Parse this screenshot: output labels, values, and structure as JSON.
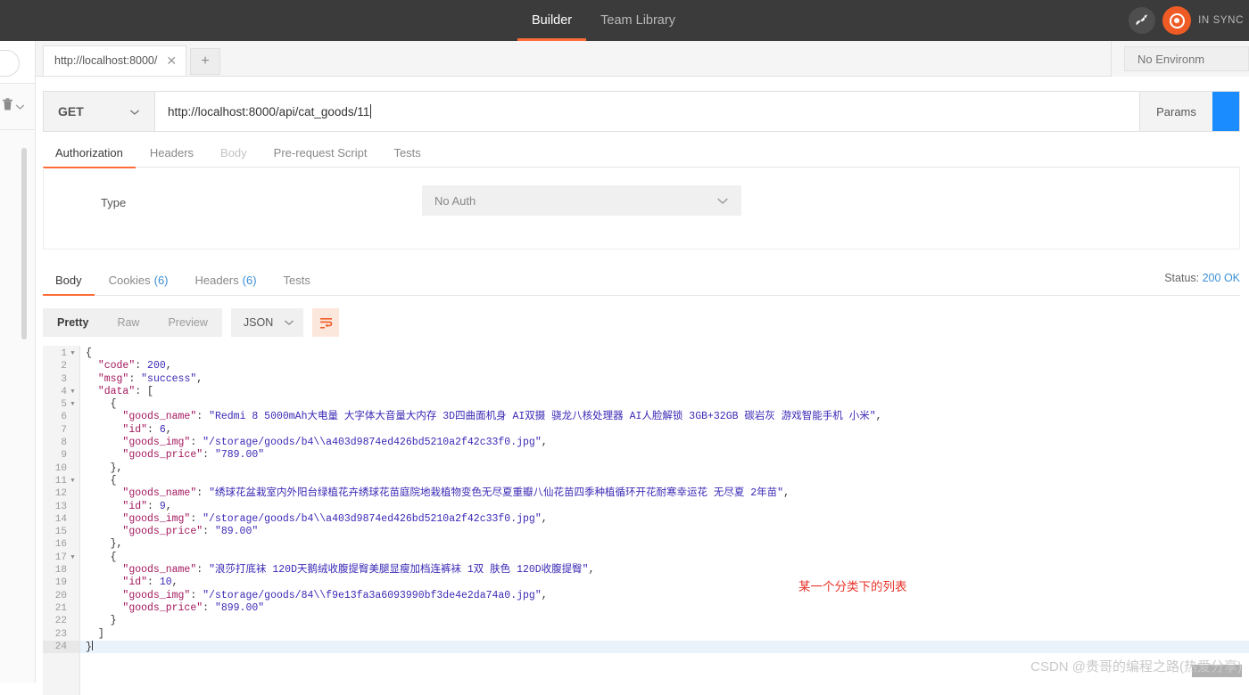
{
  "topbar": {
    "nav": [
      {
        "label": "Builder",
        "active": true
      },
      {
        "label": "Team Library",
        "active": false
      }
    ],
    "dish_icon": "satellite-dish-icon",
    "sync_logo": "postman-sync-logo",
    "sync_status": "IN SYNC"
  },
  "left_rail": {
    "trash_icon": "trash-icon",
    "chevron_icon": "chevron-down-icon"
  },
  "tabstrip": {
    "tabs": [
      {
        "label": "http://localhost:8000/",
        "close_icon": "close-icon"
      }
    ],
    "add_label": "+",
    "environment": "No Environm"
  },
  "request": {
    "method": "GET",
    "method_chevron": "chevron-down-icon",
    "url": "http://localhost:8000/api/cat_goods/11",
    "params_label": "Params",
    "tabs": [
      {
        "label": "Authorization",
        "state": "active"
      },
      {
        "label": "Headers",
        "state": "normal"
      },
      {
        "label": "Body",
        "state": "disabled"
      },
      {
        "label": "Pre-request Script",
        "state": "normal"
      },
      {
        "label": "Tests",
        "state": "normal"
      }
    ],
    "auth": {
      "type_label": "Type",
      "type_value": "No Auth",
      "chevron_icon": "chevron-down-icon"
    }
  },
  "response": {
    "tabs": [
      {
        "label": "Body",
        "count": "",
        "state": "active"
      },
      {
        "label": "Cookies",
        "count": "(6)",
        "state": "normal"
      },
      {
        "label": "Headers",
        "count": "(6)",
        "state": "normal"
      },
      {
        "label": "Tests",
        "count": "",
        "state": "normal"
      }
    ],
    "status_label": "Status:",
    "status_value": "200 OK",
    "view_modes": [
      {
        "label": "Pretty",
        "active": true
      },
      {
        "label": "Raw",
        "active": false
      },
      {
        "label": "Preview",
        "active": false
      }
    ],
    "format": "JSON",
    "format_chevron": "chevron-down-icon",
    "wrap_icon": "word-wrap-icon",
    "line_count": 24,
    "fold_lines": [
      1,
      4,
      5,
      11,
      17
    ],
    "highlight_line": 24,
    "code_lines": [
      {
        "n": 1,
        "indent": 0,
        "tokens": [
          {
            "t": "p",
            "v": "{"
          }
        ]
      },
      {
        "n": 2,
        "indent": 1,
        "tokens": [
          {
            "t": "k",
            "v": "\"code\""
          },
          {
            "t": "p",
            "v": ": "
          },
          {
            "t": "n",
            "v": "200"
          },
          {
            "t": "p",
            "v": ","
          }
        ]
      },
      {
        "n": 3,
        "indent": 1,
        "tokens": [
          {
            "t": "k",
            "v": "\"msg\""
          },
          {
            "t": "p",
            "v": ": "
          },
          {
            "t": "s",
            "v": "\"success\""
          },
          {
            "t": "p",
            "v": ","
          }
        ]
      },
      {
        "n": 4,
        "indent": 1,
        "tokens": [
          {
            "t": "k",
            "v": "\"data\""
          },
          {
            "t": "p",
            "v": ": ["
          }
        ]
      },
      {
        "n": 5,
        "indent": 2,
        "tokens": [
          {
            "t": "p",
            "v": "{"
          }
        ]
      },
      {
        "n": 6,
        "indent": 3,
        "tokens": [
          {
            "t": "k",
            "v": "\"goods_name\""
          },
          {
            "t": "p",
            "v": ": "
          },
          {
            "t": "s",
            "v": "\"Redmi 8 5000mAh大电量 大字体大音量大内存 3D四曲面机身 AI双摄 骁龙八核处理器 AI人脸解锁 3GB+32GB 碳岩灰 游戏智能手机 小米\""
          },
          {
            "t": "p",
            "v": ","
          }
        ]
      },
      {
        "n": 7,
        "indent": 3,
        "tokens": [
          {
            "t": "k",
            "v": "\"id\""
          },
          {
            "t": "p",
            "v": ": "
          },
          {
            "t": "n",
            "v": "6"
          },
          {
            "t": "p",
            "v": ","
          }
        ]
      },
      {
        "n": 8,
        "indent": 3,
        "tokens": [
          {
            "t": "k",
            "v": "\"goods_img\""
          },
          {
            "t": "p",
            "v": ": "
          },
          {
            "t": "s",
            "v": "\"/storage/goods/b4\\\\a403d9874ed426bd5210a2f42c33f0.jpg\""
          },
          {
            "t": "p",
            "v": ","
          }
        ]
      },
      {
        "n": 9,
        "indent": 3,
        "tokens": [
          {
            "t": "k",
            "v": "\"goods_price\""
          },
          {
            "t": "p",
            "v": ": "
          },
          {
            "t": "s",
            "v": "\"789.00\""
          }
        ]
      },
      {
        "n": 10,
        "indent": 2,
        "tokens": [
          {
            "t": "p",
            "v": "},"
          }
        ]
      },
      {
        "n": 11,
        "indent": 2,
        "tokens": [
          {
            "t": "p",
            "v": "{"
          }
        ]
      },
      {
        "n": 12,
        "indent": 3,
        "tokens": [
          {
            "t": "k",
            "v": "\"goods_name\""
          },
          {
            "t": "p",
            "v": ": "
          },
          {
            "t": "s",
            "v": "\"绣球花盆栽室内外阳台绿植花卉绣球花苗庭院地栽植物变色无尽夏重瓣八仙花苗四季种植循环开花耐寒幸运花 无尽夏 2年苗\""
          },
          {
            "t": "p",
            "v": ","
          }
        ]
      },
      {
        "n": 13,
        "indent": 3,
        "tokens": [
          {
            "t": "k",
            "v": "\"id\""
          },
          {
            "t": "p",
            "v": ": "
          },
          {
            "t": "n",
            "v": "9"
          },
          {
            "t": "p",
            "v": ","
          }
        ]
      },
      {
        "n": 14,
        "indent": 3,
        "tokens": [
          {
            "t": "k",
            "v": "\"goods_img\""
          },
          {
            "t": "p",
            "v": ": "
          },
          {
            "t": "s",
            "v": "\"/storage/goods/b4\\\\a403d9874ed426bd5210a2f42c33f0.jpg\""
          },
          {
            "t": "p",
            "v": ","
          }
        ]
      },
      {
        "n": 15,
        "indent": 3,
        "tokens": [
          {
            "t": "k",
            "v": "\"goods_price\""
          },
          {
            "t": "p",
            "v": ": "
          },
          {
            "t": "s",
            "v": "\"89.00\""
          }
        ]
      },
      {
        "n": 16,
        "indent": 2,
        "tokens": [
          {
            "t": "p",
            "v": "},"
          }
        ]
      },
      {
        "n": 17,
        "indent": 2,
        "tokens": [
          {
            "t": "p",
            "v": "{"
          }
        ]
      },
      {
        "n": 18,
        "indent": 3,
        "tokens": [
          {
            "t": "k",
            "v": "\"goods_name\""
          },
          {
            "t": "p",
            "v": ": "
          },
          {
            "t": "s",
            "v": "\"浪莎打底袜 120D天鹅绒收腹提臀美腿显瘦加档连裤袜 1双 肤色 120D收腹提臀\""
          },
          {
            "t": "p",
            "v": ","
          }
        ]
      },
      {
        "n": 19,
        "indent": 3,
        "tokens": [
          {
            "t": "k",
            "v": "\"id\""
          },
          {
            "t": "p",
            "v": ": "
          },
          {
            "t": "n",
            "v": "10"
          },
          {
            "t": "p",
            "v": ","
          }
        ]
      },
      {
        "n": 20,
        "indent": 3,
        "tokens": [
          {
            "t": "k",
            "v": "\"goods_img\""
          },
          {
            "t": "p",
            "v": ": "
          },
          {
            "t": "s",
            "v": "\"/storage/goods/84\\\\f9e13fa3a6093990bf3de4e2da74a0.jpg\""
          },
          {
            "t": "p",
            "v": ","
          }
        ]
      },
      {
        "n": 21,
        "indent": 3,
        "tokens": [
          {
            "t": "k",
            "v": "\"goods_price\""
          },
          {
            "t": "p",
            "v": ": "
          },
          {
            "t": "s",
            "v": "\"899.00\""
          }
        ]
      },
      {
        "n": 22,
        "indent": 2,
        "tokens": [
          {
            "t": "p",
            "v": "}"
          }
        ]
      },
      {
        "n": 23,
        "indent": 1,
        "tokens": [
          {
            "t": "p",
            "v": "]"
          }
        ]
      },
      {
        "n": 24,
        "indent": 0,
        "tokens": [
          {
            "t": "p",
            "v": "}"
          }
        ]
      }
    ]
  },
  "annotation": "某一个分类下的列表",
  "watermark": "CSDN @贵哥的编程之路(热爱分享)",
  "colors": {
    "accent": "#ff6c37",
    "topbar": "#3b3b3b",
    "link": "#3b8fd4",
    "annotation": "#e8322a"
  }
}
